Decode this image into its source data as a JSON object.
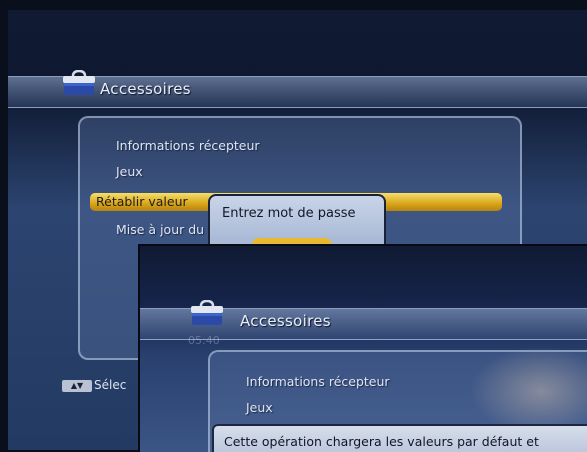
{
  "back_screen": {
    "title": "Accessoires",
    "menu_items": [
      "Informations récepteur",
      "Jeux",
      "Rétablir valeur",
      "Mise à jour du"
    ],
    "password_dialog": {
      "prompt": "Entrez mot de passe"
    },
    "status_bar": {
      "key_label": "▲▼",
      "action_label": "Sélec"
    }
  },
  "front_screen": {
    "title": "Accessoires",
    "clock": "05:40",
    "menu_items": [
      "Informations récepteur",
      "Jeux"
    ],
    "message": "Cette opération chargera les valeurs par défaut et"
  }
}
